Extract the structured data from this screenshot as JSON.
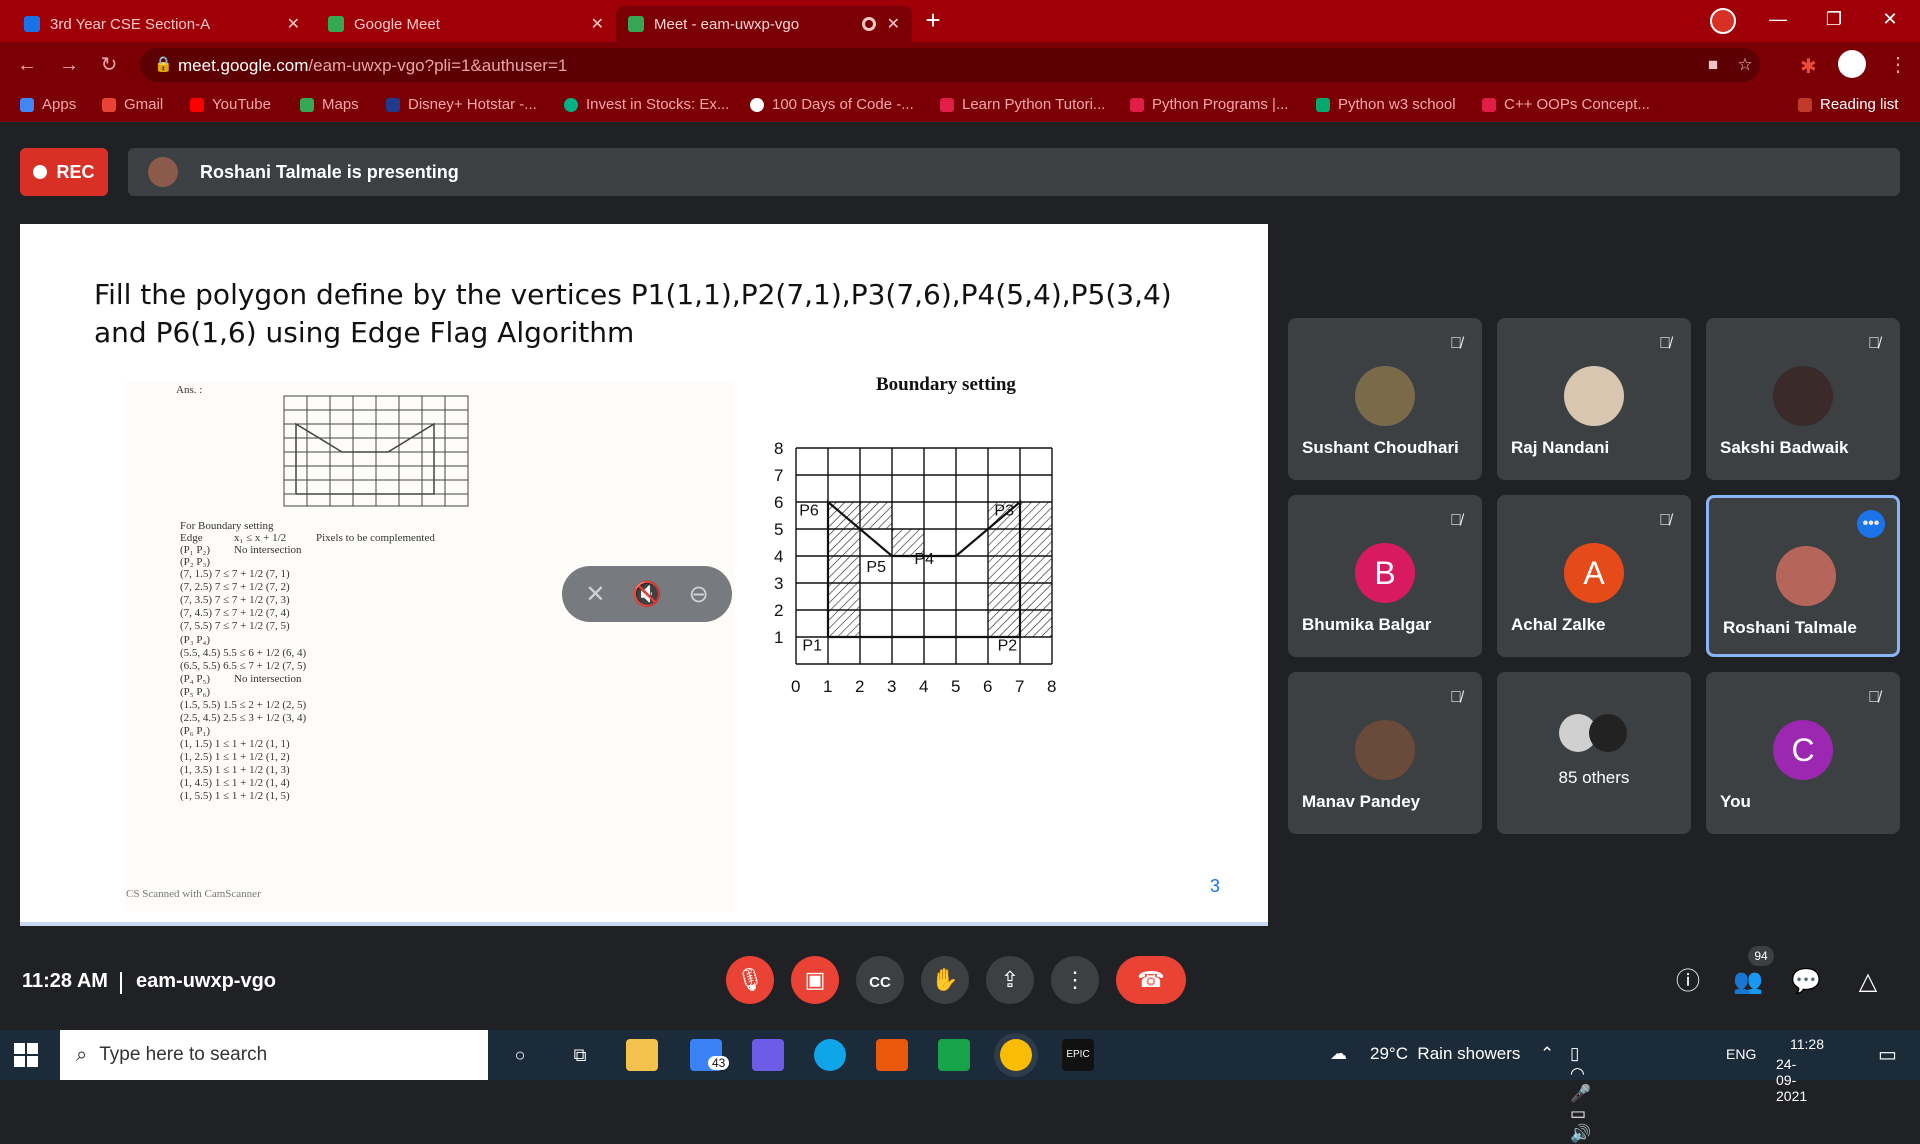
{
  "tabs": [
    {
      "title": "3rd Year CSE Section-A",
      "favicon": "classroom-icon",
      "active": false
    },
    {
      "title": "Google Meet",
      "favicon": "meet-icon",
      "active": false
    },
    {
      "title": "Meet - eam-uwxp-vgo",
      "favicon": "meet-icon",
      "active": true
    }
  ],
  "window_controls": [
    "minimize-icon",
    "restore-icon",
    "close-icon"
  ],
  "nav": {
    "url_host": "meet.google.com",
    "url_path": "/eam-uwxp-vgo?pli=1&authuser=1"
  },
  "bookmarks": [
    "Apps",
    "Gmail",
    "YouTube",
    "Maps",
    "Disney+ Hotstar -...",
    "Invest in Stocks: Ex...",
    "100 Days of Code -...",
    "Learn Python Tutori...",
    "Python Programs |...",
    "Python w3 school",
    "C++ OOPs Concept..."
  ],
  "reading_list": "Reading list",
  "meeting": {
    "rec_label": "REC",
    "presenter_text": "Roshani Talmale is presenting",
    "slide": {
      "title": "Fill the polygon define by the vertices P1(1,1),P2(7,1),P3(7,6),P4(5,4),P5(3,4) and P6(1,6) using Edge Flag Algorithm",
      "boundary_title": "Boundary setting",
      "page_number": "3",
      "scan_lines": [
        "Ans. :",
        "For Boundary setting",
        "Edge",
        "x₁ ≤ x + 1/2",
        "Pixels to be complemented",
        "(P₁ P₂)",
        "No intersection",
        "(P₂ P₃)",
        "(7, 1.5)  7 ≤ 7 + 1/2   (7, 1)",
        "(7, 2.5)  7 ≤ 7 + 1/2   (7, 2)",
        "(7, 3.5)  7 ≤ 7 + 1/2   (7, 3)",
        "(7, 4.5)  7 ≤ 7 + 1/2   (7, 4)",
        "(7, 5.5)  7 ≤ 7 + 1/2   (7, 5)",
        "(P₃ P₄)",
        "(5.5, 4.5)  5.5 ≤ 6 + 1/2   (6, 4)",
        "(6.5, 5.5)  6.5 ≤ 7 + 1/2   (7, 5)",
        "(P₄ P₅)",
        "No intersection",
        "(P₅ P₆)",
        "(1.5, 5.5)  1.5 ≤ 2 + 1/2   (2, 5)",
        "(2.5, 4.5)  2.5 ≤ 3 + 1/2   (3, 4)",
        "(P₆ P₁)",
        "(1, 1.5)  1 ≤ 1 + 1/2   (1, 1)",
        "(1, 2.5)  1 ≤ 1 + 1/2   (1, 2)",
        "(1, 3.5)  1 ≤ 1 + 1/2   (1, 3)",
        "(1, 4.5)  1 ≤ 1 + 1/2   (1, 4)",
        "(1, 5.5)  1 ≤ 1 + 1/2   (1, 5)",
        "CS Scanned with CamScanner"
      ],
      "grid_axis": [
        "0",
        "1",
        "2",
        "3",
        "4",
        "5",
        "6",
        "7",
        "8"
      ],
      "vertex_labels": [
        "P6",
        "P3",
        "P5",
        "P4",
        "P1",
        "P2"
      ],
      "hatched_cells": [
        [
          1,
          1
        ],
        [
          1,
          2
        ],
        [
          1,
          3
        ],
        [
          1,
          4
        ],
        [
          1,
          5
        ],
        [
          2,
          5
        ],
        [
          3,
          4
        ],
        [
          6,
          1
        ],
        [
          6,
          2
        ],
        [
          6,
          3
        ],
        [
          6,
          4
        ],
        [
          6,
          5
        ],
        [
          7,
          4
        ],
        [
          7,
          3
        ],
        [
          7,
          2
        ],
        [
          7,
          1
        ],
        [
          7,
          5
        ]
      ]
    },
    "participants": [
      {
        "name": "Sushant Choudhari",
        "initial": "",
        "color": "#7a6a4a",
        "muted": true
      },
      {
        "name": "Raj Nandani",
        "initial": "",
        "color": "#d9c6b0",
        "muted": true
      },
      {
        "name": "Sakshi Badwaik",
        "initial": "",
        "color": "#3a2a2a",
        "muted": true
      },
      {
        "name": "Bhumika Balgar",
        "initial": "B",
        "color": "#d81b60",
        "muted": true
      },
      {
        "name": "Achal Zalke",
        "initial": "A",
        "color": "#e64a19",
        "muted": true
      },
      {
        "name": "Roshani Talmale",
        "initial": "",
        "color": "#b5655a",
        "muted": false
      },
      {
        "name": "Manav Pandey",
        "initial": "",
        "color": "#6a4a3a",
        "muted": true
      },
      {
        "name": "85 others",
        "initial": "",
        "color": "#555",
        "muted": false
      },
      {
        "name": "You",
        "initial": "C",
        "color": "#9c27b0",
        "muted": true
      }
    ],
    "time": "11:28 AM",
    "code": "eam-uwxp-vgo",
    "people_count": "94"
  },
  "taskbar": {
    "search_placeholder": "Type here to search",
    "mail_badge": "43",
    "weather": "29°C  Rain showers",
    "lang": "ENG",
    "time": "11:28",
    "date": "24-09-2021"
  }
}
